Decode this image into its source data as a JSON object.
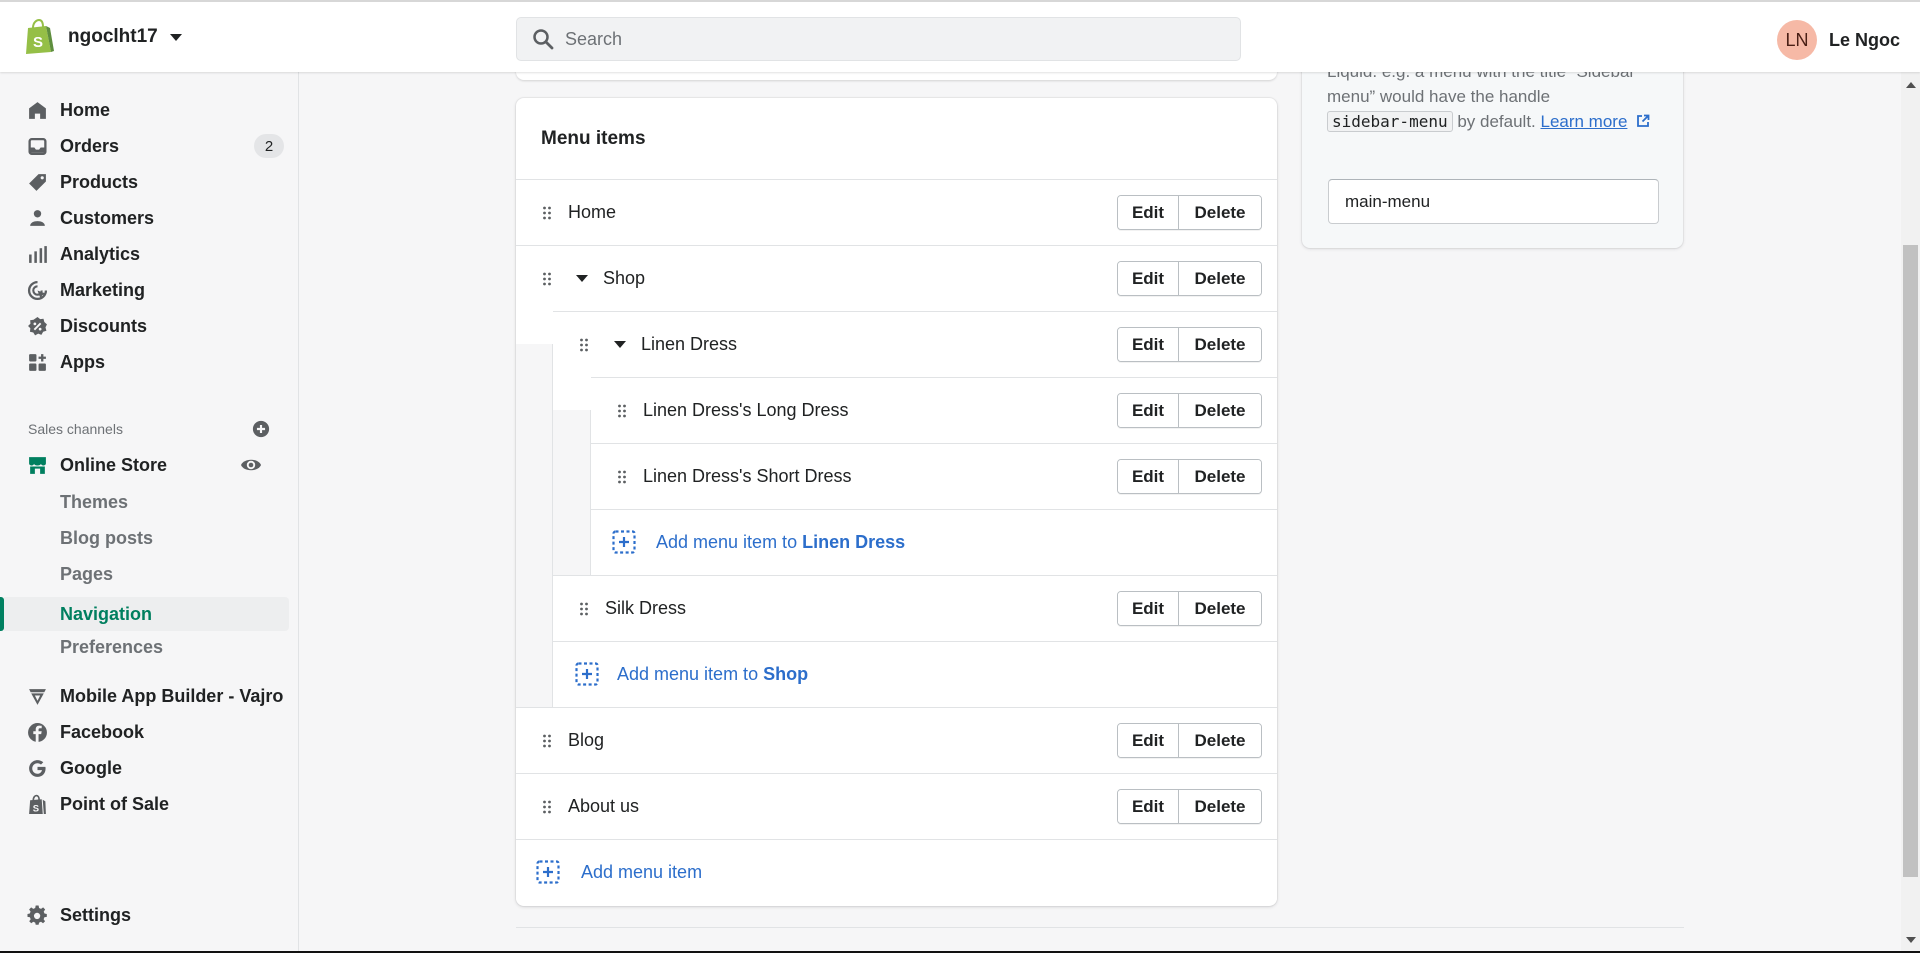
{
  "header": {
    "store_name": "ngoclht17",
    "search_placeholder": "Search",
    "user_initials": "LN",
    "user_name": "Le Ngoc",
    "avatar_color": "#f6b9a6"
  },
  "sidebar": {
    "items": [
      {
        "label": "Home",
        "icon": "home-icon"
      },
      {
        "label": "Orders",
        "icon": "orders-icon",
        "badge": "2"
      },
      {
        "label": "Products",
        "icon": "tag-icon"
      },
      {
        "label": "Customers",
        "icon": "person-icon"
      },
      {
        "label": "Analytics",
        "icon": "bar-chart-icon"
      },
      {
        "label": "Marketing",
        "icon": "marketing-icon"
      },
      {
        "label": "Discounts",
        "icon": "discount-icon"
      },
      {
        "label": "Apps",
        "icon": "apps-icon"
      }
    ],
    "sales_channels_label": "Sales channels",
    "online_store": {
      "label": "Online Store",
      "sub_items": [
        "Themes",
        "Blog posts",
        "Pages",
        "Navigation",
        "Preferences"
      ],
      "active": "Navigation"
    },
    "channels": [
      {
        "label": "Mobile App Builder - Vajro",
        "icon": "vajro-icon"
      },
      {
        "label": "Facebook",
        "icon": "facebook-icon"
      },
      {
        "label": "Google",
        "icon": "google-icon"
      },
      {
        "label": "Point of Sale",
        "icon": "pos-bag-icon"
      }
    ],
    "settings_label": "Settings",
    "accent": "#008060"
  },
  "menu_card": {
    "title": "Menu items",
    "edit_label": "Edit",
    "delete_label": "Delete",
    "items": [
      {
        "name": "Home",
        "level": 0
      },
      {
        "name": "Shop",
        "level": 0,
        "expanded": true
      },
      {
        "name": "Linen Dress",
        "level": 1,
        "expanded": true
      },
      {
        "name": "Linen Dress's Long Dress",
        "level": 2
      },
      {
        "name": "Linen Dress's Short Dress",
        "level": 2
      },
      {
        "add_prefix": "Add menu item to ",
        "add_target": "Linen Dress",
        "level": 2
      },
      {
        "name": "Silk Dress",
        "level": 1
      },
      {
        "add_prefix": "Add menu item to ",
        "add_target": "Shop",
        "level": 1
      },
      {
        "name": "Blog",
        "level": 0
      },
      {
        "name": "About us",
        "level": 0
      },
      {
        "add_prefix": "Add menu item",
        "add_target": "",
        "level": 0
      }
    ],
    "link_color": "#2c6ecb"
  },
  "handle_card": {
    "help_line1": "Liquid. e.g. a menu with the title “Sidebar",
    "help_line2": "menu” would have the handle",
    "help_code": "sidebar-menu",
    "help_after_code": " by default. ",
    "learn_more": "Learn more",
    "handle_value": "main-menu"
  }
}
